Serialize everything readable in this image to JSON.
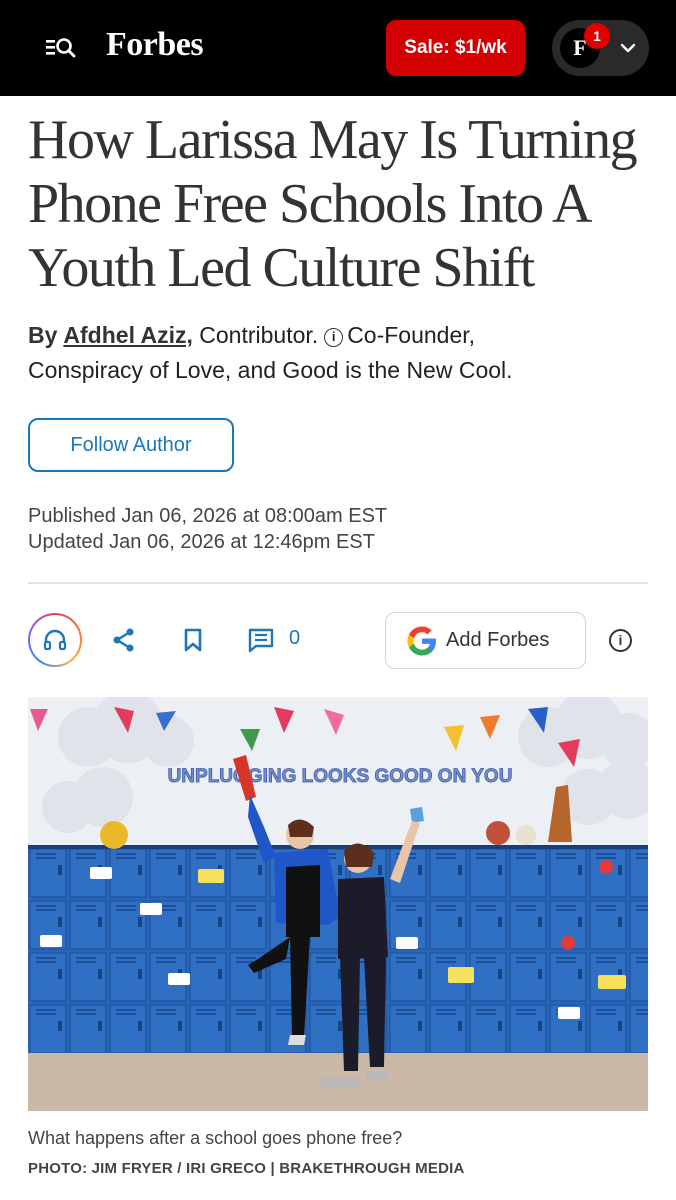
{
  "header": {
    "logo": "Forbes",
    "sale_label": "Sale: $1/wk",
    "avatar_letter": "F",
    "notification_count": "1",
    "icons": [
      "menu-search-icon",
      "chevron-down-icon"
    ]
  },
  "article": {
    "headline": "How Larissa May Is Turning Phone Free Schools Into A Youth Led Culture Shift",
    "byline": {
      "by": "By",
      "author": "Afdhel Aziz,",
      "role": "Contributor.",
      "info_glyph": "i",
      "bio_line1": "Co-Founder,",
      "bio_line2": "Conspiracy of Love, and Good is the New Cool."
    },
    "follow_label": "Follow Author",
    "published": "Published Jan 06, 2026 at 08:00am EST",
    "updated": "Updated Jan 06, 2026 at 12:46pm EST"
  },
  "actions": {
    "comment_count": "0",
    "add_forbes_label": "Add Forbes",
    "info_glyph": "i",
    "icons": [
      "headphones-icon",
      "share-icon",
      "bookmark-icon",
      "comment-icon",
      "google-icon",
      "info-icon"
    ]
  },
  "photo": {
    "banner_text": "UNPLUGGING LOOKS GOOD ON YOU",
    "caption": "What happens after a school goes phone free?",
    "credit": "PHOTO: JIM FRYER / IRI GRECO | BRAKETHROUGH MEDIA"
  },
  "colors": {
    "header_bg": "#000000",
    "sale_red": "#d20000",
    "link_blue": "#1d76b8",
    "locker_blue": "#2563b8"
  }
}
